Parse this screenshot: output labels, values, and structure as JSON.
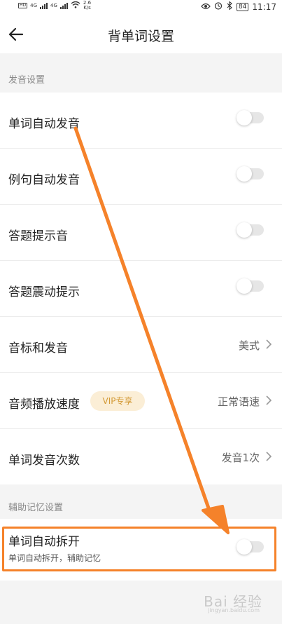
{
  "status_bar": {
    "time": "11:17",
    "battery": "84",
    "net_speed_value": "2.6",
    "net_speed_unit": "K/s",
    "hd_label": "HD",
    "sig1_label": "4G",
    "sig2_label": "4G"
  },
  "header": {
    "title": "背单词设置"
  },
  "sections": {
    "pronunciation": "发音设置",
    "memory": "辅助记忆设置"
  },
  "rows": {
    "word_auto_pronounce": {
      "label": "单词自动发音",
      "on": false
    },
    "sentence_auto_pronounce": {
      "label": "例句自动发音",
      "on": false
    },
    "answer_hint_sound": {
      "label": "答题提示音",
      "on": false
    },
    "answer_vibration": {
      "label": "答题震动提示",
      "on": false
    },
    "phonetic": {
      "label": "音标和发音",
      "value": "美式"
    },
    "audio_speed": {
      "label": "音频播放速度",
      "badge": "VIP专享",
      "value": "正常语速"
    },
    "pronounce_count": {
      "label": "单词发音次数",
      "value": "发音1次"
    },
    "word_split": {
      "label": "单词自动拆开",
      "sub": "单词自动拆开，辅助记忆",
      "on": false
    }
  },
  "colors": {
    "accent": "#f5822a",
    "vip_bg": "#fbeed6",
    "vip_text": "#d39a36"
  },
  "watermark": {
    "text": "Bai 经验",
    "sub": "jingyan.baidu.com"
  }
}
